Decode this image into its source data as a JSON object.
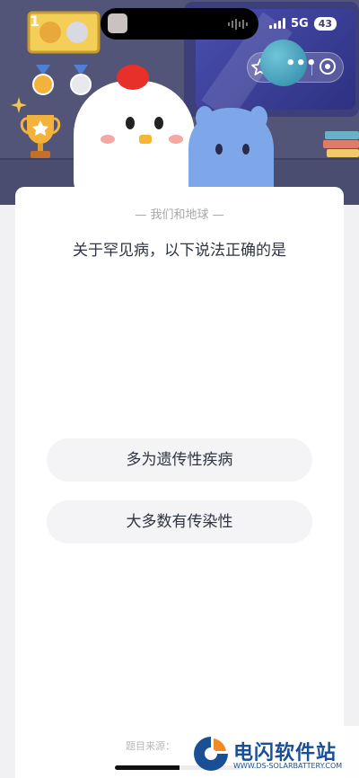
{
  "status_bar": {
    "time": "1",
    "network": "5G",
    "battery": "43"
  },
  "quiz": {
    "category": "— 我们和地球 —",
    "question": "关于罕见病，以下说法正确的是",
    "options": [
      "多为遗传性疾病",
      "大多数有传染性"
    ],
    "source": "题目来源："
  },
  "watermark": {
    "title": "电闪软件站",
    "url": "WWW.DS-SOLARBATTERY.COM"
  },
  "icons": {
    "capsule_star": "star-outline-icon",
    "capsule_more": "more-dots-icon",
    "capsule_close": "close-circle-icon",
    "signal": "signal-bars-icon"
  },
  "colors": {
    "header_bg": "#525577",
    "card_bg": "#ffffff",
    "option_bg": "#f4f4f6",
    "question_text": "#2f3442",
    "watermark_brand": "#1a4f95"
  }
}
